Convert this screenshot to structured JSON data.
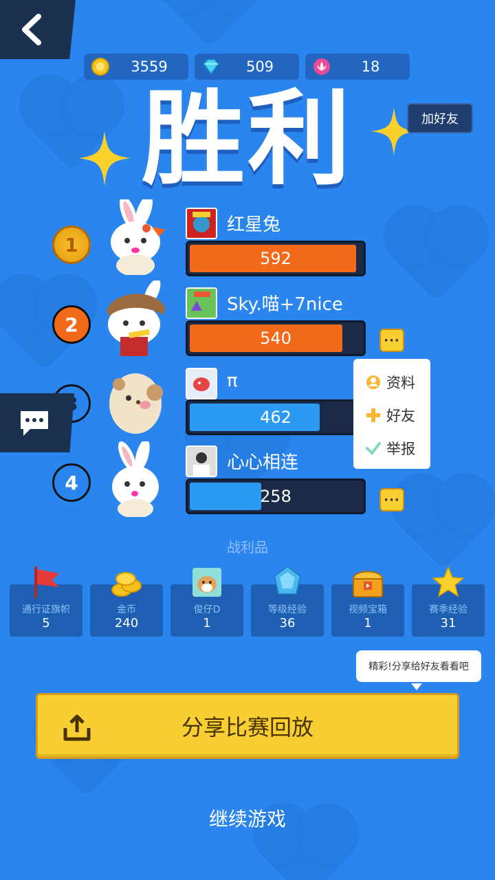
{
  "currency": [
    {
      "icon": "gold-coin-icon",
      "value": "3559"
    },
    {
      "icon": "diamond-icon",
      "value": "509"
    },
    {
      "icon": "lotus-icon",
      "value": "18"
    }
  ],
  "title": "胜利",
  "add_friend_label": "加好友",
  "players": [
    {
      "rank": "1",
      "name": "红星兔",
      "score": "592",
      "fill": 0.97,
      "bar_color": "orange"
    },
    {
      "rank": "2",
      "name": "Sky.喵+7nice",
      "score": "540",
      "fill": 0.89,
      "bar_color": "orange"
    },
    {
      "rank": "3",
      "name": "π",
      "score": "462",
      "fill": 0.76,
      "bar_color": "blue"
    },
    {
      "rank": "4",
      "name": "心心相连",
      "score": "258",
      "fill": 0.43,
      "bar_color": "blue"
    }
  ],
  "popup_menu": [
    {
      "icon": "profile-icon",
      "label": "资料"
    },
    {
      "icon": "plus-icon",
      "label": "好友"
    },
    {
      "icon": "check-icon",
      "label": "举报"
    }
  ],
  "loot_title": "战利品",
  "loot": [
    {
      "icon": "flag-icon",
      "label": "通行证旗帜",
      "count": "5"
    },
    {
      "icon": "coins-icon",
      "label": "金币",
      "count": "240"
    },
    {
      "icon": "dog-icon",
      "label": "俊仔D",
      "count": "1"
    },
    {
      "icon": "crystal-icon",
      "label": "等级经验",
      "count": "36"
    },
    {
      "icon": "treasure-chest-icon",
      "label": "视频宝箱",
      "count": "1"
    },
    {
      "icon": "star-icon",
      "label": "赛季经验",
      "count": "31"
    }
  ],
  "share_bubble": "精彩!分享给好友看看吧",
  "share_button": "分享比赛回放",
  "continue_label": "继续游戏",
  "colors": {
    "background": "#2a86ee",
    "orange_bar": "#f26a19",
    "blue_bar": "#2a9af2",
    "button_yellow": "#f7cf33"
  }
}
